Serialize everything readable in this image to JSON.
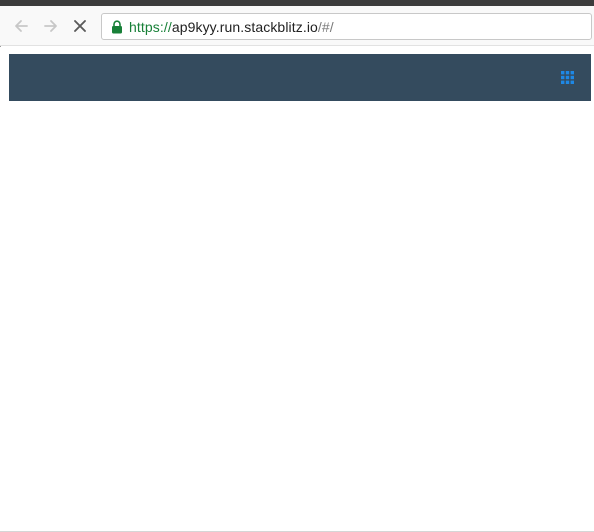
{
  "browser": {
    "address_bar": {
      "scheme": "https://",
      "host": "ap9kyy.run.stackblitz.io",
      "path": "/#/"
    },
    "icons": {
      "back": "arrow-left-icon",
      "forward": "arrow-right-icon",
      "stop": "close-icon",
      "secure": "lock-icon"
    },
    "colors": {
      "secure_scheme": "#188038"
    }
  },
  "app": {
    "navbar": {
      "background": "#344b5e",
      "menu_icon": "grid-icon",
      "menu_icon_color": "#1e88e5"
    }
  }
}
